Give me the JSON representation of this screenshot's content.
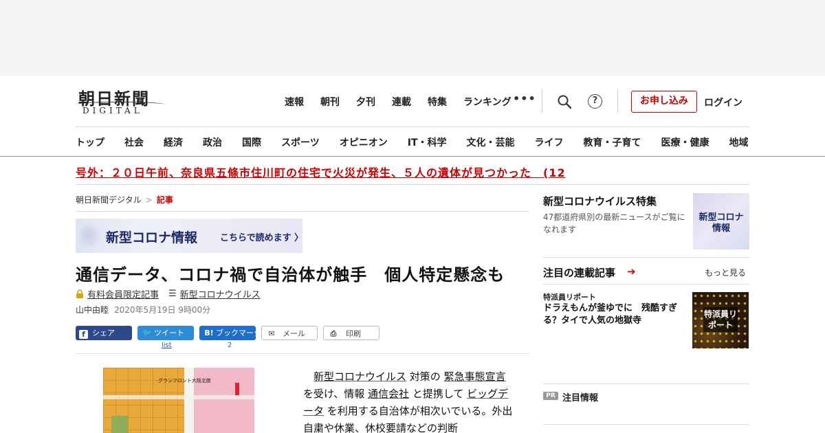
{
  "header": {
    "logo_main": "朝日新聞",
    "logo_sub": "DIGITAL",
    "topnav": [
      "速報",
      "朝刊",
      "夕刊",
      "連載",
      "特集",
      "ランキング"
    ],
    "more": "•••",
    "help": "?",
    "signup_label": "お申し込み",
    "login_label": "ログイン",
    "accent_color": "#cc0000"
  },
  "categories": [
    "トップ",
    "社会",
    "経済",
    "政治",
    "国際",
    "スポーツ",
    "オピニオン",
    "IT・科学",
    "文化・芸能",
    "ライフ",
    "教育・子育て",
    "医療・健康",
    "地域"
  ],
  "breaking": "号外：２０日午前、奈良県五條市住川町の住宅で火災が発生、５人の遺体が見つかった　(12",
  "breadcrumb": {
    "home": "朝日新聞デジタル",
    "sep": ">",
    "current": "記事"
  },
  "banner": {
    "title": "新型コロナ情報",
    "sub": "こちらで読めます 〉"
  },
  "article": {
    "headline": "通信データ、コロナ禍で自治体が触手　個人特定懸念も",
    "members_only": "有料会員限定記事",
    "tag": "新型コロナウイルス",
    "author": "山中由睦",
    "date": "2020年5月19日 9時00分",
    "body": {
      "p1_a": "新型コロナウイルス",
      "p1_b": " 対策の ",
      "p1_c": "緊急事態宣言",
      "p1_d": " を受け、情報 ",
      "p1_e": "通信会社",
      "p1_f": " と提携して ",
      "p1_g": "ビッグデータ",
      "p1_h": " を利用する自治体が相次いでいる。外出自粛や休業、休校要請などの判断"
    },
    "map_label": "グランフロント大阪北館"
  },
  "share": {
    "facebook": "シェア",
    "twitter": "ツイート",
    "twitter_count": "list",
    "hatena_icon": "B!",
    "hatena": "ブックマーク",
    "hatena_count": "2",
    "mail": "メール",
    "print": "印刷"
  },
  "sidebar": {
    "feature_title": "新型コロナウイルス特集",
    "feature_desc": "47都道府県別の最新ニュースがご覧になれます",
    "feature_img_text": "新型コロナ情報",
    "series_title": "注目の連載記事",
    "series_arrow": "➔",
    "more": "もっと見る",
    "item_category": "特派員リポート",
    "item_title": "ドラえもんが釜ゆでに　残酷すぎる？タイで人気の地獄寺",
    "item_img_text": "特派員リポート",
    "pr_badge": "PR",
    "pr_label": "注目情報"
  }
}
